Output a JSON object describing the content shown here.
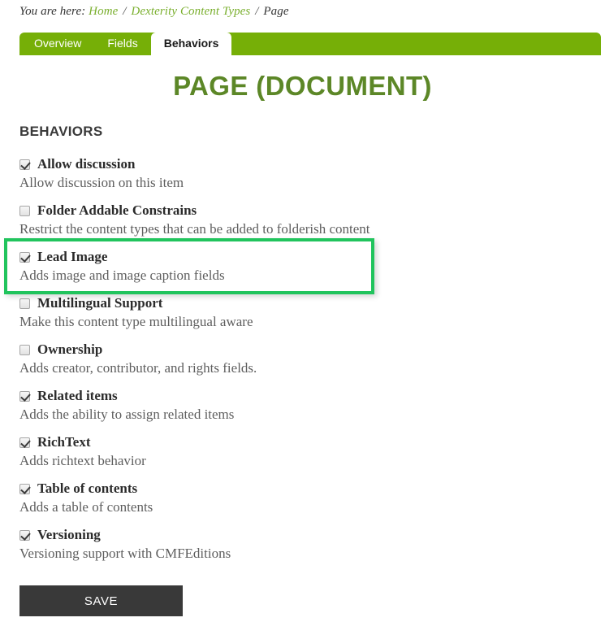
{
  "breadcrumb": {
    "label": "You are here:",
    "separator": "/",
    "items": [
      {
        "text": "Home",
        "type": "link"
      },
      {
        "text": "Dexterity Content Types",
        "type": "link"
      },
      {
        "text": "Page",
        "type": "current"
      }
    ]
  },
  "tabs": [
    {
      "label": "Overview",
      "active": false
    },
    {
      "label": "Fields",
      "active": false
    },
    {
      "label": "Behaviors",
      "active": true
    }
  ],
  "page": {
    "title": "PAGE (DOCUMENT)",
    "section_heading": "BEHAVIORS"
  },
  "behaviors": [
    {
      "label": "Allow discussion",
      "description": "Allow discussion on this item",
      "checked": true,
      "highlighted": false
    },
    {
      "label": "Folder Addable Constrains",
      "description": "Restrict the content types that can be added to folderish content",
      "checked": false,
      "highlighted": false
    },
    {
      "label": "Lead Image",
      "description": "Adds image and image caption fields",
      "checked": true,
      "highlighted": true
    },
    {
      "label": "Multilingual Support",
      "description": "Make this content type multilingual aware",
      "checked": false,
      "highlighted": false
    },
    {
      "label": "Ownership",
      "description": "Adds creator, contributor, and rights fields.",
      "checked": false,
      "highlighted": false
    },
    {
      "label": "Related items",
      "description": "Adds the ability to assign related items",
      "checked": true,
      "highlighted": false
    },
    {
      "label": "RichText",
      "description": "Adds richtext behavior",
      "checked": true,
      "highlighted": false
    },
    {
      "label": "Table of contents",
      "description": "Adds a table of contents",
      "checked": true,
      "highlighted": false
    },
    {
      "label": "Versioning",
      "description": "Versioning support with CMFEditions",
      "checked": true,
      "highlighted": false
    }
  ],
  "actions": {
    "save_label": "SAVE"
  },
  "colors": {
    "nav_green": "#76af07",
    "title_green": "#5c8727",
    "link_green": "#7aaf2e",
    "highlight_green": "#21c45d",
    "save_bg": "#393939"
  }
}
